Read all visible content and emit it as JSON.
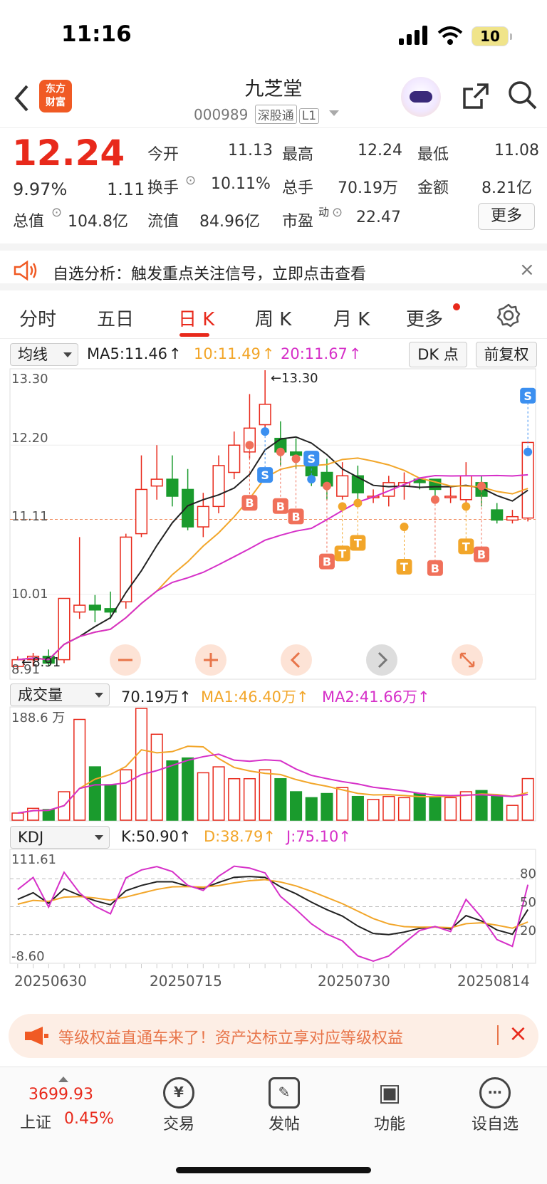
{
  "status_bar": {
    "time": "11:16",
    "battery": "10"
  },
  "header": {
    "logo": "东方\n财富",
    "stock_name": "九芝堂",
    "code": "000989",
    "tag1": "深股通",
    "tag2": "L1"
  },
  "quote": {
    "price": "12.24",
    "change_pct": "9.97%",
    "change": "1.11",
    "open_label": "今开",
    "open": "11.13",
    "high_label": "最高",
    "high": "12.24",
    "low_label": "最低",
    "low": "11.08",
    "turnover_label": "换手",
    "turnover": "10.11%",
    "volume_label": "总手",
    "volume": "70.19万",
    "amount_label": "金额",
    "amount": "8.21亿",
    "mktcap_label": "总值",
    "mktcap": "104.8亿",
    "float_label": "流值",
    "float": "84.96亿",
    "pe_label": "市盈",
    "pe_sup": "动",
    "pe": "22.47",
    "more_button": "更多"
  },
  "analysis_banner": {
    "text": "自选分析：触发重点关注信号，立即点击查看"
  },
  "tabs": [
    "分时",
    "五日",
    "日 K",
    "周 K",
    "月 K",
    "更多"
  ],
  "active_tab": "日 K",
  "kline": {
    "indicator_select": "均线",
    "ma5": "MA5:11.46",
    "ma10": "10:11.49",
    "ma20": "20:11.67",
    "dk_button": "DK 点",
    "adjust_button": "前复权",
    "y_labels": [
      "13.30",
      "12.20",
      "11.11",
      "10.01",
      "8.91"
    ],
    "high_marker": "←13.30",
    "low_marker": "←8.91"
  },
  "volume": {
    "select": "成交量",
    "value": "70.19万",
    "ma1": "MA1:46.40万",
    "ma2": "MA2:41.66万",
    "y_max": "188.6 万"
  },
  "kdj": {
    "select": "KDJ",
    "k": "K:50.90",
    "d": "D:38.79",
    "j": "J:75.10",
    "y_max": "111.61",
    "y_min": "-8.60",
    "levels": [
      "80",
      "50",
      "20"
    ]
  },
  "x_dates": [
    "20250630",
    "20250715",
    "20250730",
    "20250814"
  ],
  "promo_banner": {
    "text": "等级权益直通车来了！资产达标立享对应等级权益"
  },
  "index": {
    "value": "3699.93",
    "name": "上证",
    "pct": "0.45%"
  },
  "bottom_nav": [
    "交易",
    "发帖",
    "功能",
    "设自选"
  ],
  "colors": {
    "up": "#e8291b",
    "down": "#1a9b2d",
    "ma5": "#222222",
    "ma10": "#f2a62a",
    "ma20": "#d630c8"
  },
  "chart_data": {
    "type": "candlestick",
    "title": "",
    "dates_shown": [
      "20250630",
      "20250715",
      "20250730",
      "20250814"
    ],
    "ylim": [
      8.91,
      13.3
    ],
    "candles": [
      {
        "o": 8.95,
        "c": 9.05,
        "h": 9.1,
        "l": 8.91
      },
      {
        "o": 9.05,
        "c": 9.1,
        "h": 9.15,
        "l": 8.95
      },
      {
        "o": 9.1,
        "c": 9.0,
        "h": 9.2,
        "l": 8.95
      },
      {
        "o": 9.05,
        "c": 9.95,
        "h": 9.95,
        "l": 9.0
      },
      {
        "o": 9.75,
        "c": 9.85,
        "h": 10.85,
        "l": 9.65
      },
      {
        "o": 9.85,
        "c": 9.78,
        "h": 10.0,
        "l": 9.6
      },
      {
        "o": 9.8,
        "c": 9.75,
        "h": 10.05,
        "l": 9.65
      },
      {
        "o": 9.9,
        "c": 10.85,
        "h": 10.9,
        "l": 9.8
      },
      {
        "o": 10.9,
        "c": 11.55,
        "h": 12.05,
        "l": 10.85
      },
      {
        "o": 11.6,
        "c": 11.7,
        "h": 12.2,
        "l": 11.4
      },
      {
        "o": 11.7,
        "c": 11.45,
        "h": 12.05,
        "l": 11.3
      },
      {
        "o": 11.55,
        "c": 11.0,
        "h": 11.85,
        "l": 10.95
      },
      {
        "o": 11.0,
        "c": 11.3,
        "h": 11.5,
        "l": 10.85
      },
      {
        "o": 11.3,
        "c": 11.9,
        "h": 12.05,
        "l": 11.2
      },
      {
        "o": 11.8,
        "c": 12.2,
        "h": 12.4,
        "l": 11.7
      },
      {
        "o": 12.1,
        "c": 12.45,
        "h": 12.95,
        "l": 12.0
      },
      {
        "o": 12.5,
        "c": 12.8,
        "h": 13.3,
        "l": 12.4
      },
      {
        "o": 12.3,
        "c": 12.1,
        "h": 12.55,
        "l": 11.9
      },
      {
        "o": 12.1,
        "c": 12.05,
        "h": 12.3,
        "l": 11.85
      },
      {
        "o": 11.95,
        "c": 11.75,
        "h": 12.1,
        "l": 11.6
      },
      {
        "o": 11.8,
        "c": 11.6,
        "h": 12.0,
        "l": 11.4
      },
      {
        "o": 11.45,
        "c": 11.75,
        "h": 11.95,
        "l": 11.4
      },
      {
        "o": 11.75,
        "c": 11.5,
        "h": 11.9,
        "l": 11.35
      },
      {
        "o": 11.45,
        "c": 11.45,
        "h": 11.55,
        "l": 11.35
      },
      {
        "o": 11.45,
        "c": 11.65,
        "h": 11.75,
        "l": 11.3
      },
      {
        "o": 11.6,
        "c": 11.65,
        "h": 11.8,
        "l": 11.4
      },
      {
        "o": 11.7,
        "c": 11.65,
        "h": 11.7,
        "l": 11.55
      },
      {
        "o": 11.7,
        "c": 11.55,
        "h": 11.7,
        "l": 11.45
      },
      {
        "o": 11.45,
        "c": 11.45,
        "h": 11.6,
        "l": 11.35
      },
      {
        "o": 11.4,
        "c": 11.75,
        "h": 11.95,
        "l": 11.35
      },
      {
        "o": 11.65,
        "c": 11.45,
        "h": 11.75,
        "l": 11.3
      },
      {
        "o": 11.25,
        "c": 11.1,
        "h": 11.35,
        "l": 11.05
      },
      {
        "o": 11.1,
        "c": 11.15,
        "h": 11.25,
        "l": 11.05
      },
      {
        "o": 11.13,
        "c": 12.24,
        "h": 12.24,
        "l": 11.08
      }
    ],
    "volume_max": 188.6,
    "volumes": [
      12,
      20,
      18,
      48,
      170,
      90,
      60,
      85,
      188.6,
      145,
      100,
      105,
      80,
      90,
      70,
      70,
      85,
      70,
      48,
      38,
      45,
      55,
      40,
      35,
      40,
      38,
      45,
      40,
      38,
      48,
      50,
      40,
      25,
      70.19
    ],
    "kdj_ylim": [
      -8.6,
      111.61
    ]
  }
}
